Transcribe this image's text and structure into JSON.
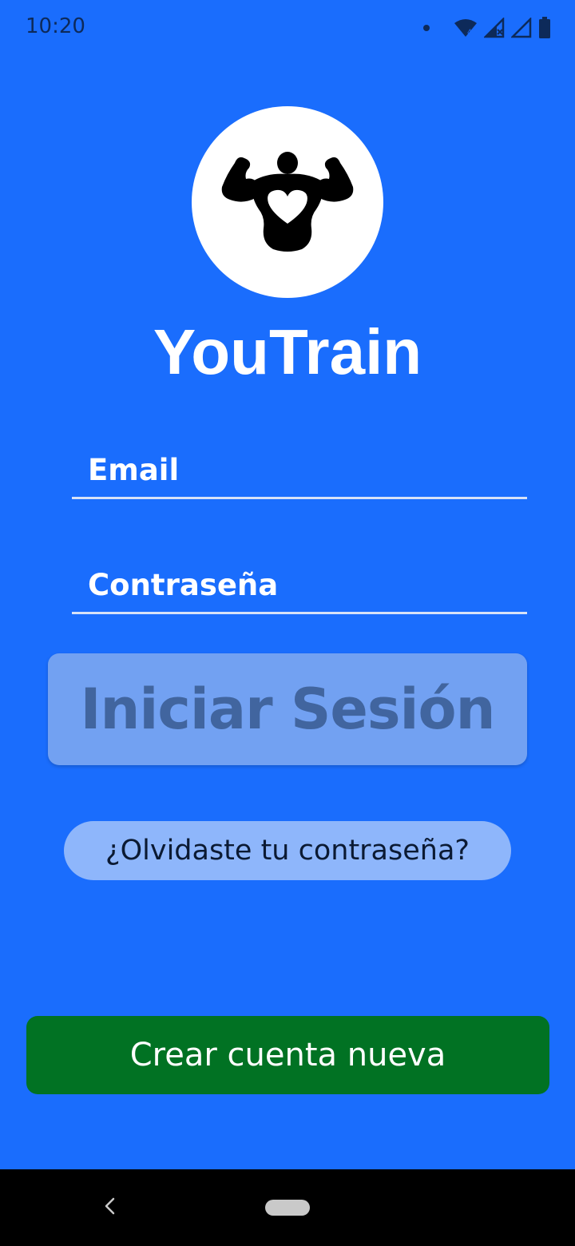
{
  "status_bar": {
    "time": "10:20",
    "icons": [
      "notification-dot-icon",
      "wifi-icon",
      "signal-icon",
      "signal-no-data-icon",
      "battery-icon"
    ]
  },
  "app": {
    "logo_icon": "bodybuilder-heart-icon",
    "title": "YouTrain"
  },
  "form": {
    "email_placeholder": "Email",
    "email_value": "",
    "password_placeholder": "Contraseña",
    "password_value": "",
    "login_label": "Iniciar Sesión",
    "forgot_label": "¿Olvidaste tu contraseña?"
  },
  "footer": {
    "create_account_label": "Crear cuenta nueva"
  },
  "nav_bar": {
    "icons": [
      "back-icon",
      "home-pill-icon"
    ]
  },
  "colors": {
    "background": "#1a6dfd",
    "login_button": "#72a1f2",
    "forgot_button": "#8eb6fb",
    "create_button": "#017223"
  }
}
